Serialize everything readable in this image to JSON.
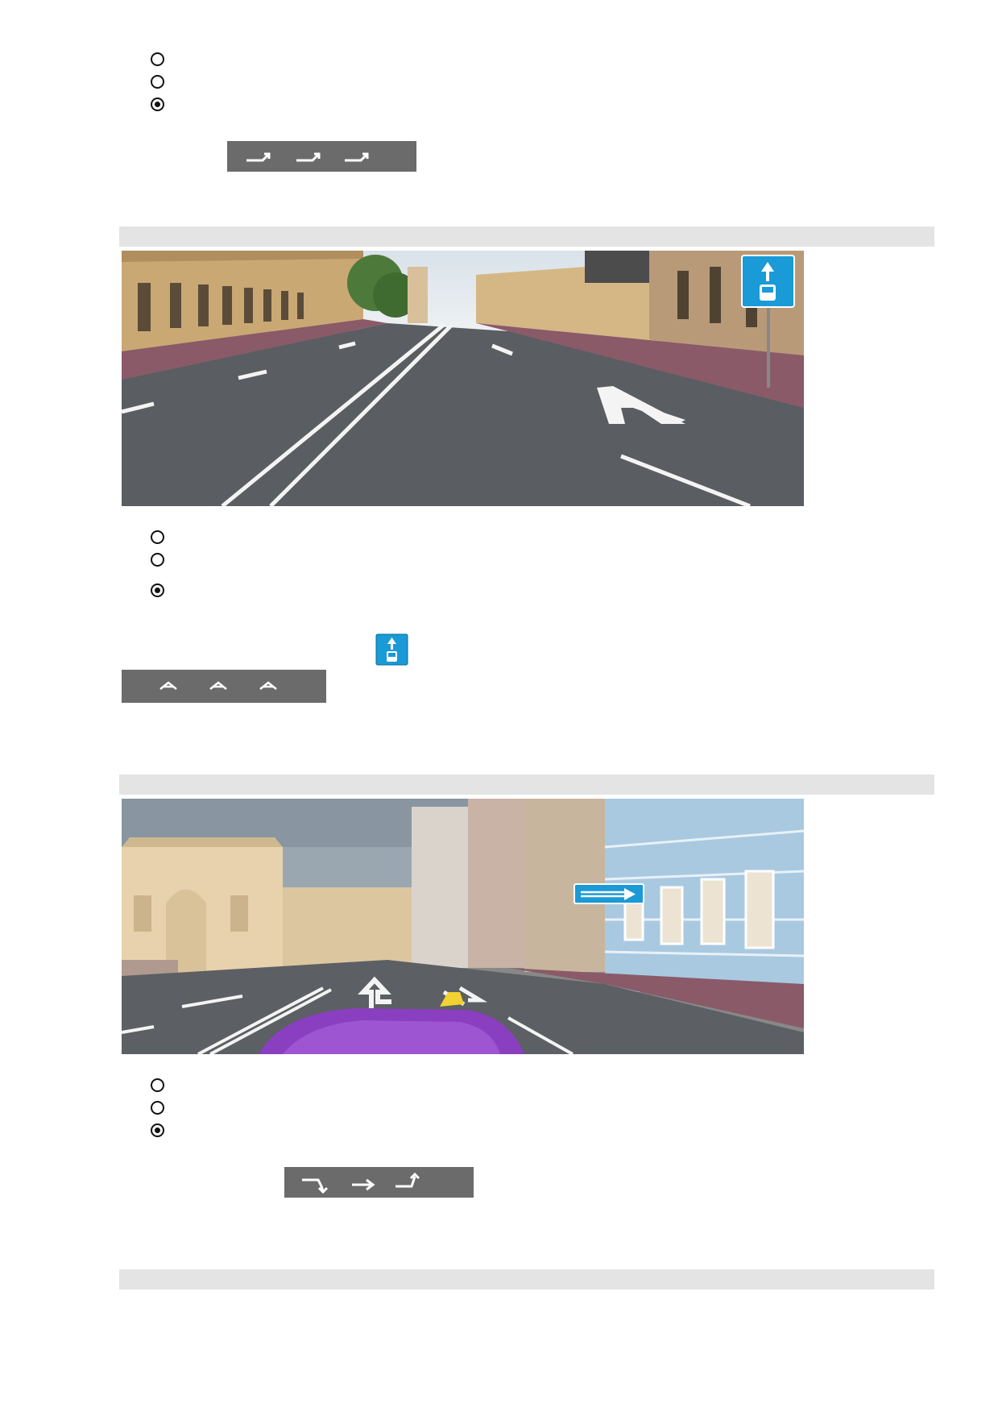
{
  "questions": [
    {
      "options": [
        {
          "checked": false
        },
        {
          "checked": false
        },
        {
          "checked": true
        }
      ],
      "marking_icon": "lane-arrows-right-marking"
    },
    {
      "scene_icons": [
        "bus-lane-sign-icon",
        "lane-letter-a-marking",
        "double-solid-line"
      ],
      "options": [
        {
          "checked": false
        },
        {
          "checked": false
        },
        {
          "checked": true
        }
      ],
      "sign_icon": "bus-lane-sign-icon",
      "marking_icon": "letter-a-marking"
    },
    {
      "scene_icons": [
        "direction-right-sign-icon",
        "straight-left-arrow-marking",
        "purple-car-hood"
      ],
      "options": [
        {
          "checked": false
        },
        {
          "checked": false
        },
        {
          "checked": true
        }
      ],
      "marking_icon": "lane-shift-arrows-marking"
    }
  ],
  "colors": {
    "separator": "#e4e4e4",
    "marking_bg": "#6b6b6b",
    "sign_blue": "#1a9ad6",
    "car": "#8a3fc0"
  }
}
